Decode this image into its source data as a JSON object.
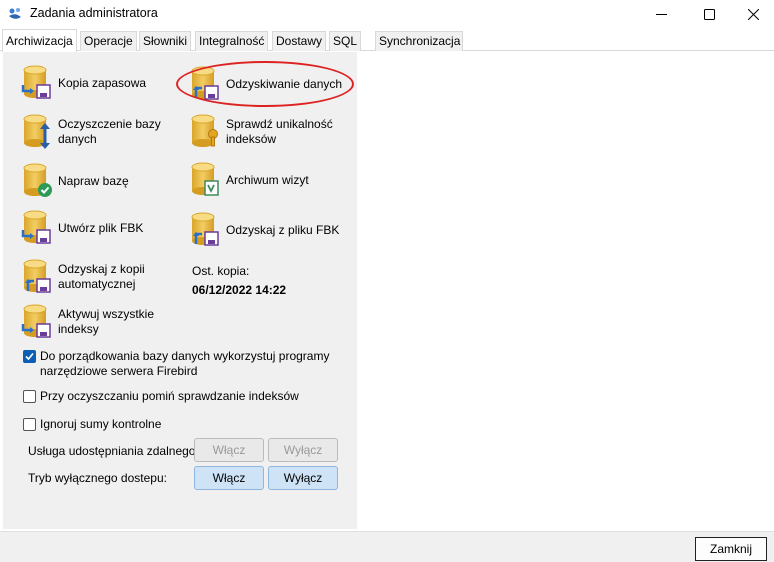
{
  "window": {
    "title": "Zadania administratora",
    "controls": [
      "minimize-icon",
      "maximize-icon",
      "close-icon"
    ]
  },
  "tabs": [
    {
      "label": "Archiwizacja",
      "active": true
    },
    {
      "label": "Operacje"
    },
    {
      "label": "Słowniki"
    },
    {
      "label": "Integralność"
    },
    {
      "label": "Dostawy"
    },
    {
      "label": "SQL"
    },
    {
      "label": "Synchronizacja"
    }
  ],
  "tasks": {
    "kopia": {
      "label": "Kopia zapasowa",
      "icon": "database-backup-icon"
    },
    "odzyskiwanie": {
      "label": "Odzyskiwanie danych",
      "icon": "database-restore-icon"
    },
    "oczyszczenie": {
      "label": "Oczyszczenie bazy danych",
      "icon": "database-clean-icon"
    },
    "unikalnosc": {
      "label": "Sprawdź unikalność indeksów",
      "icon": "database-key-icon"
    },
    "napraw": {
      "label": "Napraw bazę",
      "icon": "database-repair-icon"
    },
    "archiwum": {
      "label": "Archiwum wizyt",
      "icon": "database-archive-icon"
    },
    "utworz_fbk": {
      "label": "Utwórz plik FBK",
      "icon": "database-backup-icon"
    },
    "odzyskaj_fbk": {
      "label": "Odzyskaj z pliku FBK",
      "icon": "database-restore-icon"
    },
    "odzyskaj_auto": {
      "label": "Odzyskaj z kopii automatycznej",
      "icon": "database-restore-icon"
    },
    "aktywuj": {
      "label": "Aktywuj wszystkie indeksy",
      "icon": "database-backup-icon"
    }
  },
  "last_backup": {
    "label": "Ost. kopia:",
    "value": "06/12/2022 14:22"
  },
  "options": {
    "firebird_tools": {
      "label": "Do porządkowania bazy danych wykorzystuj programy narzędziowe serwera Firebird",
      "checked": true
    },
    "skip_index_check": {
      "label": "Przy oczyszczaniu pomiń sprawdzanie indeksów",
      "checked": false
    },
    "ignore_checksums": {
      "label": "Ignoruj sumy kontrolne",
      "checked": false
    }
  },
  "remote_sharing": {
    "label": "Usługa udostępniania zdalnego:",
    "on_label": "Włącz",
    "off_label": "Wyłącz"
  },
  "exclusive_mode": {
    "label": "Tryb wyłącznego dostepu:",
    "on_label": "Włącz",
    "off_label": "Wyłącz"
  },
  "footer": {
    "close_label": "Zamknij"
  },
  "colors": {
    "annotation_circle": "#dd2222",
    "db_gold": "#e8bc45",
    "accent_blue": "#0a5fb4"
  }
}
